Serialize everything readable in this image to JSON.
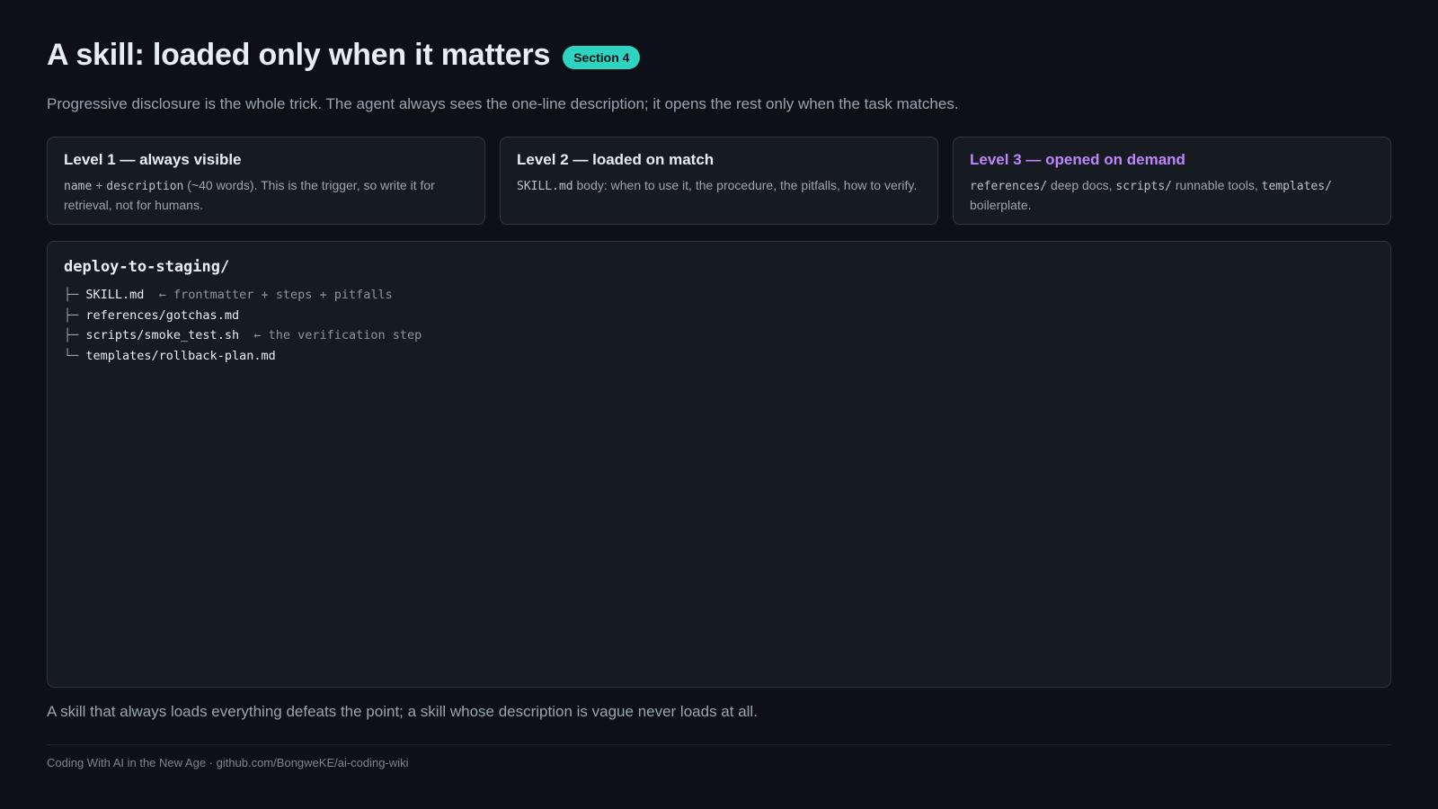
{
  "header": {
    "title": "A skill: loaded only when it matters",
    "badge": "Section 4",
    "subtitle": "Progressive disclosure is the whole trick. The agent always sees the one-line description; it opens the rest only when the task matches."
  },
  "levels": [
    {
      "title": "Level 1 — always visible",
      "code1": "name",
      "text1": " + ",
      "code2": "description",
      "text2": " (~40 words). This is the trigger, so write it for retrieval, not for humans."
    },
    {
      "title": "Level 2 — loaded on match",
      "code1": "SKILL.md",
      "text1": " body: when to use it, the procedure, the pitfalls, how to verify."
    },
    {
      "title": "Level 3 — opened on demand",
      "code1": "references/",
      "text1": " deep docs, ",
      "code2": "scripts/",
      "text2": " runnable tools, ",
      "code3": "templates/",
      "text3": " boilerplate."
    }
  ],
  "tree": {
    "root": "deploy-to-staging/",
    "items": [
      {
        "branch": "├─ ",
        "name": "SKILL.md",
        "note": "  ← frontmatter + steps + pitfalls"
      },
      {
        "branch": "├─ ",
        "name": "references/gotchas.md",
        "note": ""
      },
      {
        "branch": "├─ ",
        "name": "scripts/smoke_test.sh",
        "note": "  ← the verification step"
      },
      {
        "branch": "└─ ",
        "name": "templates/rollback-plan.md",
        "note": ""
      }
    ]
  },
  "closing": "A skill that always loads everything defeats the point; a skill whose description is vague never loads at all.",
  "footer": "Coding With AI in the New Age · github.com/BongweKE/ai-coding-wiki",
  "colors": {
    "accent_teal": "#2dd4bf",
    "accent_purple": "#c084fc",
    "background": "#0d1117",
    "card": "#161b22"
  }
}
